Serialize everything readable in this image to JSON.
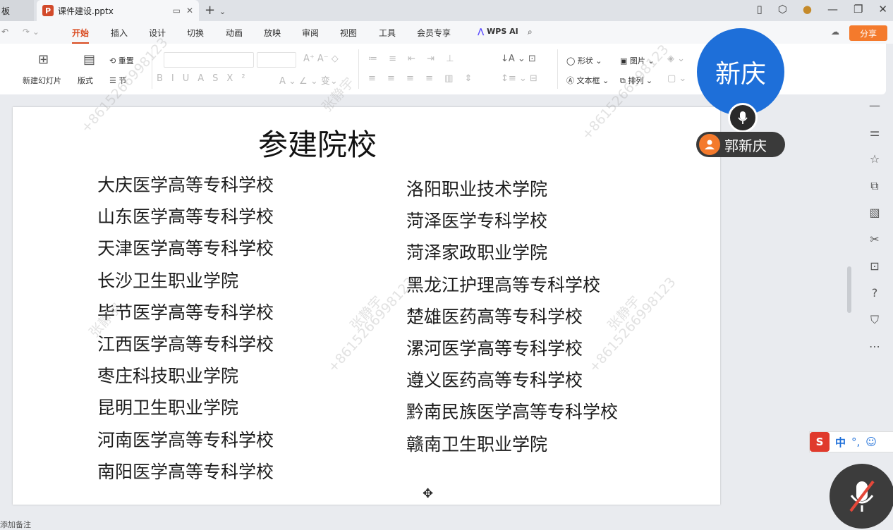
{
  "tabs": {
    "prev_label": "板",
    "active_label": "课件建设.pptx",
    "ppt_icon_letter": "P"
  },
  "menu": {
    "items": [
      "开始",
      "插入",
      "设计",
      "切换",
      "动画",
      "放映",
      "审阅",
      "视图",
      "工具",
      "会员专享"
    ],
    "wps_ai": "WPS AI",
    "share": "分享"
  },
  "ribbon": {
    "new_slide": "新建幻灯片",
    "layout": "版式",
    "reset": "重置",
    "section": "节",
    "shape": "形状",
    "picture": "图片",
    "textbox": "文本框",
    "arrange": "排列"
  },
  "slide": {
    "title": "参建院校",
    "left_column": [
      "大庆医学高等专科学校",
      "山东医学高等专科学校",
      "天津医学高等专科学校",
      "长沙卫生职业学院",
      "毕节医学高等专科学校",
      "江西医学高等专科学校",
      "枣庄科技职业学院",
      "昆明卫生职业学院",
      "河南医学高等专科学校",
      "南阳医学高等专科学校"
    ],
    "right_column": [
      "洛阳职业技术学院",
      "菏泽医学专科学校",
      "菏泽家政职业学院",
      "黑龙江护理高等专科学校",
      "楚雄医药高等专科学校",
      "漯河医学高等专科学校",
      "遵义医药高等专科学校",
      "黔南民族医学高等专科学校",
      "赣南卫生职业学院"
    ]
  },
  "watermark": {
    "name": "张静宇",
    "phone": "+8615266998123"
  },
  "meeting": {
    "avatar_text": "新庆",
    "speaker_name": "郭新庆"
  },
  "ime": {
    "logo": "S",
    "mode": "中",
    "punct": "°,",
    "emoji": "☺"
  },
  "statusbar": {
    "notes": "添加备注"
  },
  "colors": {
    "accent": "#d94a1f",
    "share_bg": "#f47a2c",
    "avatar_bg": "#1e6fd9"
  }
}
